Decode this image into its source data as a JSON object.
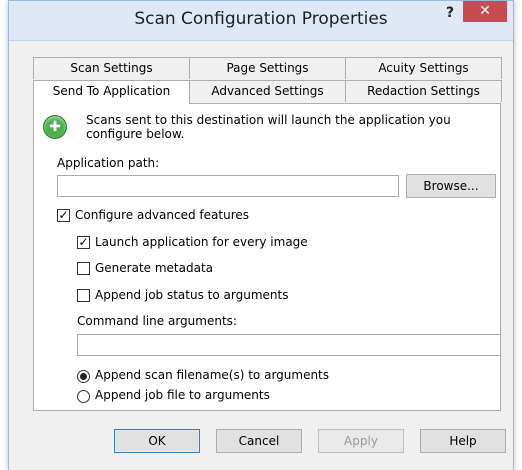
{
  "window": {
    "title": "Scan Configuration Properties",
    "help_glyph": "?",
    "close_glyph": "✕"
  },
  "tabs": {
    "row1": [
      "Scan Settings",
      "Page Settings",
      "Acuity Settings"
    ],
    "row2": [
      "Send To Application",
      "Advanced Settings",
      "Redaction Settings"
    ],
    "active": "Send To Application"
  },
  "panel": {
    "info_text": "Scans sent to this destination will launch the application you configure below.",
    "app_path_label": "Application path:",
    "app_path_value": "",
    "browse_label": "Browse...",
    "configure_advanced": {
      "label": "Configure advanced features",
      "checked": true
    },
    "launch_every_image": {
      "label": "Launch application for every image",
      "checked": true
    },
    "generate_metadata": {
      "label": "Generate metadata",
      "checked": false
    },
    "append_job_status": {
      "label": "Append job status to arguments",
      "checked": false
    },
    "cmd_args_label": "Command line arguments:",
    "cmd_args_value": "",
    "radio_scan_filename": {
      "label": "Append scan filename(s) to arguments",
      "selected": true
    },
    "radio_job_file": {
      "label": "Append job file to arguments",
      "selected": false
    }
  },
  "buttons": {
    "ok": "OK",
    "cancel": "Cancel",
    "apply": "Apply",
    "help": "Help"
  },
  "colors": {
    "close_button": "#c74b50",
    "title_bar": "#dfe9f5",
    "info_icon": "#4caf50"
  }
}
